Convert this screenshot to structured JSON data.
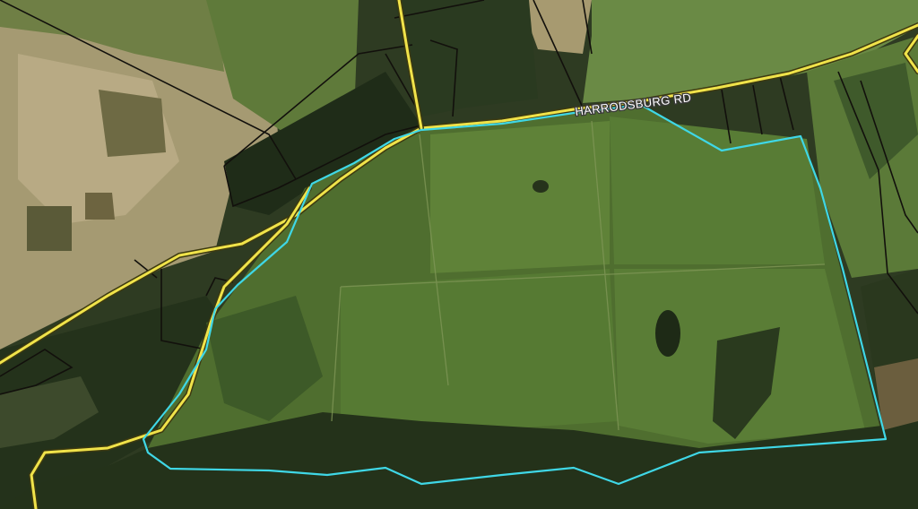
{
  "map": {
    "type": "aerial-imagery",
    "road_label": "HARRODSBURG RD",
    "colors": {
      "road_casing": "#3d3a10",
      "road_line": "#f0e34a",
      "parcel_boundary": "#12100c",
      "selected_parcel": "#3fd7e6",
      "pasture": "#5b7a36",
      "woodland": "#22301a",
      "bare_ground": "#b9a982"
    }
  }
}
